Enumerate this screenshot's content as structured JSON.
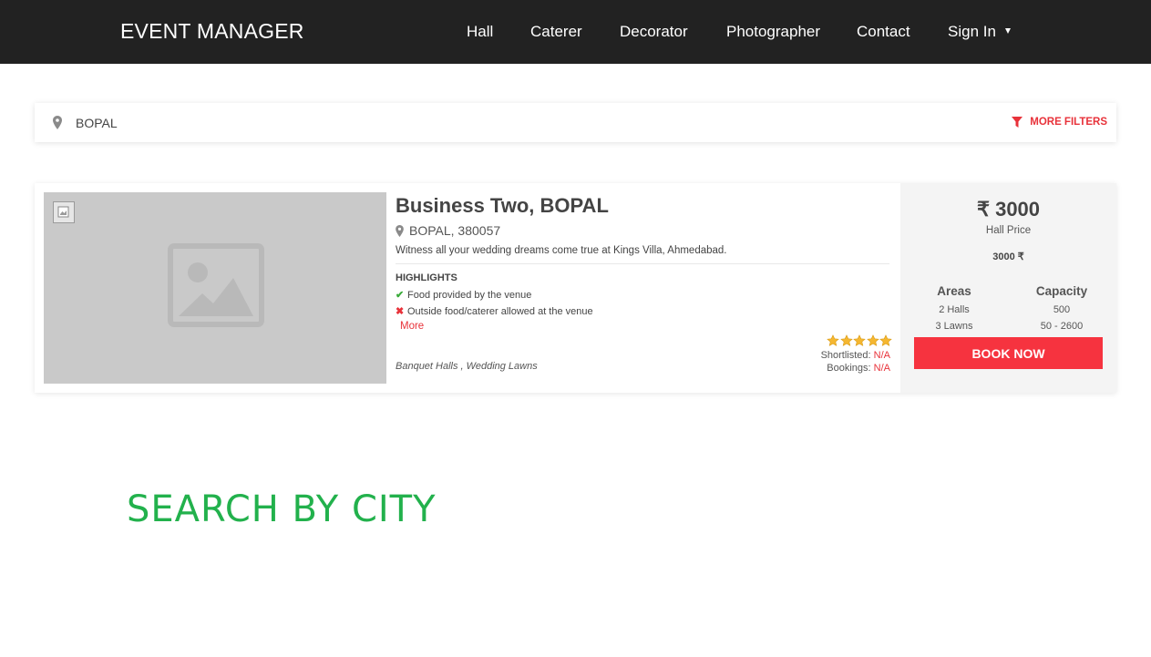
{
  "nav": {
    "brand": "EVENT MANAGER",
    "items": [
      "Hall",
      "Caterer",
      "Decorator",
      "Photographer",
      "Contact"
    ],
    "signin": "Sign In"
  },
  "search": {
    "location_icon": "map-marker-icon",
    "value": "BOPAL",
    "filter_icon": "funnel-icon",
    "filter_label": "MORE FILTERS"
  },
  "listing": {
    "image_icon": "broken-image-icon",
    "title": "Business Two, BOPAL",
    "location": "BOPAL, 380057",
    "description": "Witness all your wedding dreams come true at Kings Villa, Ahmedabad.",
    "highlights_title": "HIGHLIGHTS",
    "highlights": [
      {
        "icon": "check-icon",
        "text": "Food provided by the venue"
      },
      {
        "icon": "cross-icon",
        "text": "Outside food/caterer allowed at the venue"
      }
    ],
    "more_label": "More",
    "categories": "Banquet Halls , Wedding Lawns",
    "rating": 5,
    "shortlisted_label": "Shortlisted:",
    "shortlisted_value": "N/A",
    "bookings_label": "Bookings:",
    "bookings_value": "N/A"
  },
  "pricing": {
    "price": "₹ 3000",
    "price_label": "Hall Price",
    "price_secondary": "3000 ₹",
    "areas_header": "Areas",
    "areas": [
      "2 Halls",
      "3 Lawns"
    ],
    "capacity_header": "Capacity",
    "capacity": [
      "500",
      "50 - 2600"
    ],
    "book_label": "BOOK NOW"
  },
  "section": {
    "title": "SEARCH BY CITY"
  },
  "colors": {
    "navbar": "#222222",
    "accent_red": "#e8323a",
    "book_button": "#f6333f",
    "section_green": "#22b14c",
    "star": "#f5b731",
    "check_green": "#3aab3a"
  }
}
